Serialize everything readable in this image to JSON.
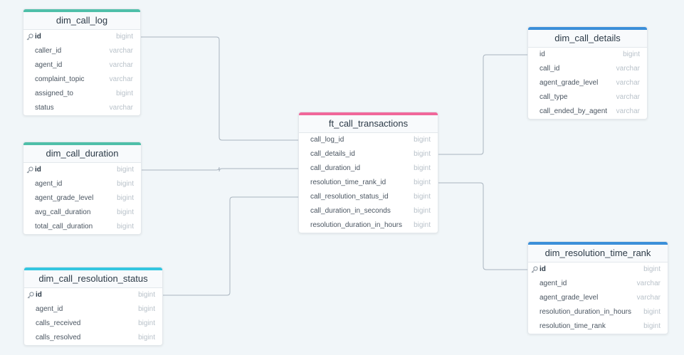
{
  "colors": {
    "teal": "#4fbfa9",
    "blue": "#3b8fd9",
    "pink": "#f0679a",
    "cyan": "#33c6e0",
    "connector": "#a9b4bf"
  },
  "tables": {
    "dim_call_log": {
      "name": "dim_call_log",
      "columns": [
        {
          "name": "id",
          "type": "bigint",
          "pk": true
        },
        {
          "name": "caller_id",
          "type": "varchar"
        },
        {
          "name": "agent_id",
          "type": "varchar"
        },
        {
          "name": "complaint_topic",
          "type": "varchar"
        },
        {
          "name": "assigned_to",
          "type": "bigint"
        },
        {
          "name": "status",
          "type": "varchar"
        }
      ]
    },
    "dim_call_duration": {
      "name": "dim_call_duration",
      "columns": [
        {
          "name": "id",
          "type": "bigint",
          "pk": true
        },
        {
          "name": "agent_id",
          "type": "bigint"
        },
        {
          "name": "agent_grade_level",
          "type": "bigint"
        },
        {
          "name": "avg_call_duration",
          "type": "bigint"
        },
        {
          "name": "total_call_duration",
          "type": "bigint"
        }
      ]
    },
    "dim_call_resolution_status": {
      "name": "dim_call_resolution_status",
      "columns": [
        {
          "name": "id",
          "type": "bigint",
          "pk": true
        },
        {
          "name": "agent_id",
          "type": "bigint"
        },
        {
          "name": "calls_received",
          "type": "bigint"
        },
        {
          "name": "calls_resolved",
          "type": "bigint"
        }
      ]
    },
    "ft_call_transactions": {
      "name": "ft_call_transactions",
      "columns": [
        {
          "name": "call_log_id",
          "type": "bigint"
        },
        {
          "name": "call_details_id",
          "type": "bigint"
        },
        {
          "name": "call_duration_id",
          "type": "bigint"
        },
        {
          "name": "resolution_time_rank_id",
          "type": "bigint"
        },
        {
          "name": "call_resolution_status_id",
          "type": "bigint"
        },
        {
          "name": "call_duration_in_seconds",
          "type": "bigint"
        },
        {
          "name": "resolution_duration_in_hours",
          "type": "bigint"
        }
      ]
    },
    "dim_call_details": {
      "name": "dim_call_details",
      "columns": [
        {
          "name": "id",
          "type": "bigint"
        },
        {
          "name": "call_id",
          "type": "varchar"
        },
        {
          "name": "agent_grade_level",
          "type": "varchar"
        },
        {
          "name": "call_type",
          "type": "varchar"
        },
        {
          "name": "call_ended_by_agent",
          "type": "varchar"
        }
      ]
    },
    "dim_resolution_time_rank": {
      "name": "dim_resolution_time_rank",
      "columns": [
        {
          "name": "id",
          "type": "bigint",
          "pk": true
        },
        {
          "name": "agent_id",
          "type": "varchar"
        },
        {
          "name": "agent_grade_level",
          "type": "varchar"
        },
        {
          "name": "resolution_duration_in_hours",
          "type": "bigint"
        },
        {
          "name": "resolution_time_rank",
          "type": "bigint"
        }
      ]
    }
  },
  "relations": [
    {
      "from": "ft_call_transactions.call_log_id",
      "to": "dim_call_log.id"
    },
    {
      "from": "ft_call_transactions.call_duration_id",
      "to": "dim_call_duration.id"
    },
    {
      "from": "ft_call_transactions.call_resolution_status_id",
      "to": "dim_call_resolution_status.id"
    },
    {
      "from": "ft_call_transactions.call_details_id",
      "to": "dim_call_details.id"
    },
    {
      "from": "ft_call_transactions.resolution_time_rank_id",
      "to": "dim_resolution_time_rank.id"
    }
  ]
}
